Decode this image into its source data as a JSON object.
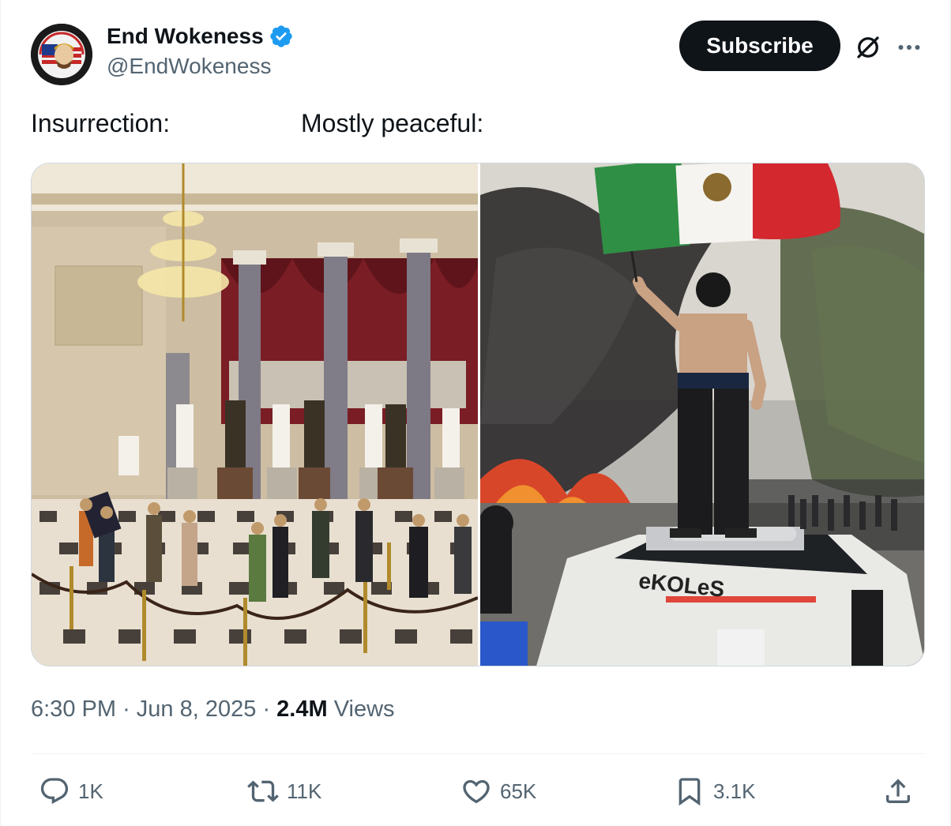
{
  "author": {
    "display_name": "End Wokeness",
    "handle": "@EndWokeness",
    "verified": true,
    "avatar_text_top": "I SUPPORT THE",
    "avatar_text_bottom": "FORMER THING"
  },
  "header": {
    "subscribe_label": "Subscribe",
    "icons": [
      "grok-icon",
      "more-icon"
    ]
  },
  "post": {
    "text_left": "Insurrection:",
    "text_right": "Mostly peaceful:"
  },
  "media": {
    "left_image": "Crowd walking through the Capitol Statuary Hall between stanchion ropes",
    "right_image": "Shirtless man in mask waving Mexican flag atop a vandalized police car amid fire and smoke",
    "car_graffiti": "eKOLeS"
  },
  "meta": {
    "time": "6:30 PM",
    "date": "Jun 8, 2025",
    "separator": "·",
    "views_count": "2.4M",
    "views_label": "Views"
  },
  "actions": {
    "replies": "1K",
    "reposts": "11K",
    "likes": "65K",
    "bookmarks": "3.1K"
  },
  "colors": {
    "text_primary": "#0f1419",
    "text_secondary": "#536471",
    "verified_blue": "#1d9bf0",
    "subscribe_bg": "#0f1419"
  }
}
